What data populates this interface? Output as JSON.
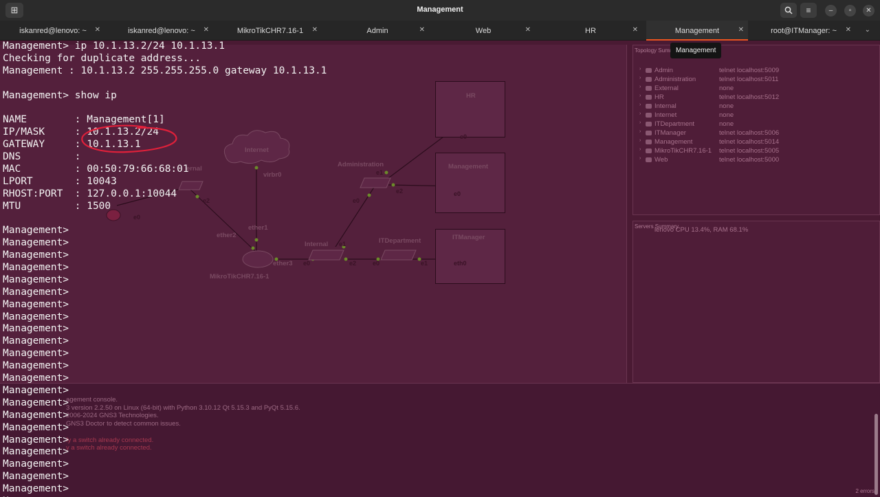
{
  "window": {
    "title": "Management"
  },
  "tabs": [
    {
      "label": "iskanred@lenovo: ~",
      "active": false
    },
    {
      "label": "iskanred@lenovo: ~",
      "active": false
    },
    {
      "label": "MikroTikCHR7.16-1",
      "active": false
    },
    {
      "label": "Admin",
      "active": false
    },
    {
      "label": "Web",
      "active": false
    },
    {
      "label": "HR",
      "active": false
    },
    {
      "label": "Management",
      "active": true
    },
    {
      "label": "root@ITManager: ~",
      "active": false
    }
  ],
  "tooltip": "Management",
  "terminal": {
    "lines": [
      "Management> ip 10.1.13.2/24 10.1.13.1",
      "Checking for duplicate address...",
      "Management : 10.1.13.2 255.255.255.0 gateway 10.1.13.1",
      "",
      "Management> show ip",
      "",
      "NAME        : Management[1]",
      "IP/MASK     : 10.1.13.2/24",
      "GATEWAY     : 10.1.13.1",
      "DNS         :",
      "MAC         : 00:50:79:66:68:01",
      "LPORT       : 10043",
      "RHOST:PORT  : 127.0.0.1:10044",
      "MTU         : 1500",
      "",
      "Management>",
      "Management>",
      "Management>",
      "Management>",
      "Management>",
      "Management>",
      "Management>",
      "Management>",
      "Management>",
      "Management>",
      "Management>",
      "Management>",
      "Management>",
      "Management>",
      "Management>",
      "Management>",
      "Management>",
      "Management>",
      "Management>",
      "Management>",
      "Management>",
      "Management>",
      "Management>"
    ],
    "prompt": "Management> "
  },
  "background": {
    "topology_header": "Topology Summary",
    "topology": [
      {
        "name": "Admin",
        "console": "telnet localhost:5009"
      },
      {
        "name": "Administration",
        "console": "telnet localhost:5011"
      },
      {
        "name": "External",
        "console": "none"
      },
      {
        "name": "HR",
        "console": "telnet localhost:5012"
      },
      {
        "name": "Internal",
        "console": "none"
      },
      {
        "name": "Internet",
        "console": "none"
      },
      {
        "name": "ITDepartment",
        "console": "none"
      },
      {
        "name": "ITManager",
        "console": "telnet localhost:5006"
      },
      {
        "name": "Management",
        "console": "telnet localhost:5014"
      },
      {
        "name": "MikroTikCHR7.16-1",
        "console": "telnet localhost:5005"
      },
      {
        "name": "Web",
        "console": "telnet localhost:5000"
      }
    ],
    "servers_header": "Servers Summary",
    "server": "lenovo CPU 13.4%, RAM 68.1%",
    "console_lines": [
      {
        "text": "agement console.",
        "err": false
      },
      {
        "text": "3 version 2.2.50 on Linux (64-bit) with Python 3.10.12 Qt 5.15.3 and PyQt 5.15.6.",
        "err": false
      },
      {
        "text": "2006-2024 GNS3 Technologies.",
        "err": false
      },
      {
        "text": "GNS3 Doctor to detect common issues.",
        "err": false
      },
      {
        "text": "",
        "err": false
      },
      {
        "text": "fy a switch already connected.",
        "err": true
      },
      {
        "text": "y a switch already connected.",
        "err": true
      }
    ],
    "errors_count": "2 errors",
    "diagram_labels": {
      "internet": "Internet",
      "virbr0": "virbr0",
      "ether1": "ether1",
      "ether2": "ether2",
      "ether3": "ether3",
      "router": "MikroTikCHR7.16-1",
      "internal": "Internal",
      "external": "ernal",
      "administration": "Administration",
      "itdepartment": "ITDepartment",
      "hr": "HR",
      "management": "Management",
      "itmanager": "ITManager",
      "e0": "e0",
      "e1": "e1",
      "e2": "e2",
      "eth0": "eth0"
    }
  }
}
